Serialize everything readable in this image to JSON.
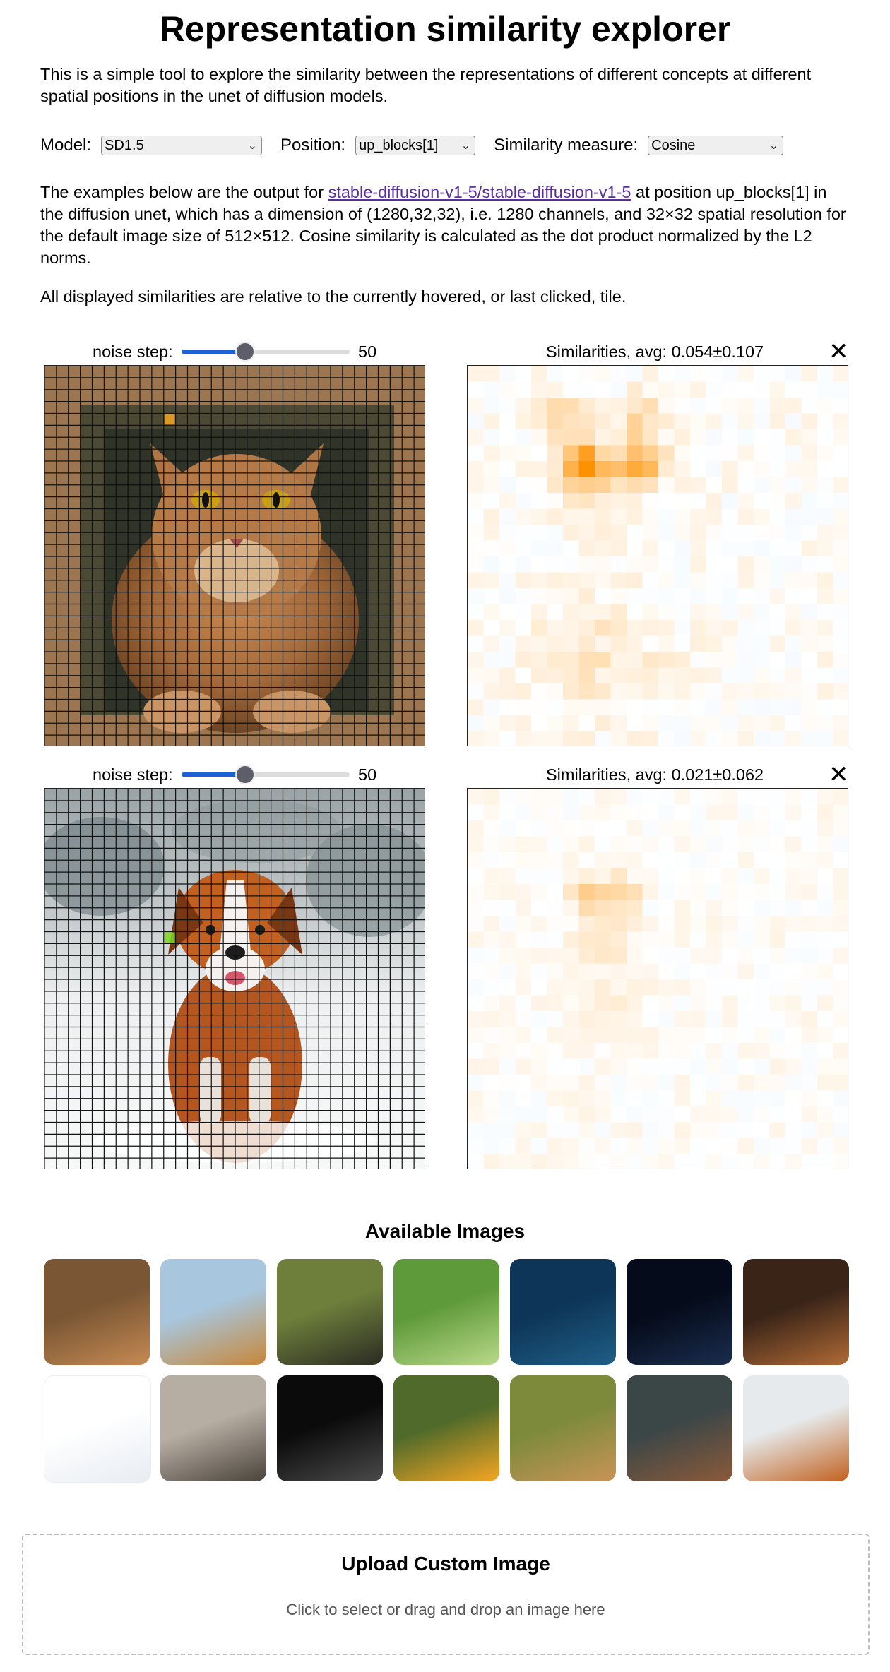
{
  "page": {
    "title": "Representation similarity explorer",
    "intro": "This is a simple tool to explore the similarity between the representations of different concepts at different spatial positions in the unet of diffusion models."
  },
  "controls": {
    "model_label": "Model:",
    "model_value": "SD1.5",
    "position_label": "Position:",
    "position_value": "up_blocks[1]",
    "measure_label": "Similarity measure:",
    "measure_value": "Cosine"
  },
  "description": {
    "prefix": "The examples below are the output for ",
    "link_text": "stable-diffusion-v1-5/stable-diffusion-v1-5",
    "suffix": " at position up_blocks[1] in the diffusion unet, which has a dimension of (1280,32,32), i.e. 1280 channels, and 32×32 spatial resolution for the default image size of 512×512. Cosine similarity is calculated as the dot product normalized by the L2 norms.",
    "note": "All displayed similarities are relative to the currently hovered, or last clicked, tile."
  },
  "examples": [
    {
      "noise_label": "noise step:",
      "noise_value": "50",
      "noise_fraction": 0.36,
      "similarity_label": "Similarities, avg: 0.054±0.107",
      "close": "✕",
      "image": "cat-in-frame",
      "selected_tile": [
        4,
        10
      ],
      "selected_color": "#f5a623"
    },
    {
      "noise_label": "noise step:",
      "noise_value": "50",
      "noise_fraction": 0.36,
      "similarity_label": "Similarities, avg: 0.021±0.062",
      "close": "✕",
      "image": "dog-in-snow",
      "selected_tile": [
        12,
        10
      ],
      "selected_color": "#7ed321"
    }
  ],
  "gallery": {
    "title": "Available Images",
    "items": [
      "cat-in-frame",
      "mountain-river",
      "black-cat-grass",
      "green-forest",
      "whale-ocean",
      "night-storm",
      "steampunk-interior",
      "screenshot",
      "samurai",
      "lightning-dark",
      "butterfly-flower",
      "cats-grass",
      "cabin-woods",
      "dog-snow"
    ]
  },
  "upload": {
    "title": "Upload Custom Image",
    "hint": "Click to select or drag and drop an image here"
  },
  "colors": {
    "accent": "#1a62d6",
    "link": "#5a2e9e",
    "heat_pos": "#f59a00",
    "heat_neg": "#4a90e2"
  }
}
